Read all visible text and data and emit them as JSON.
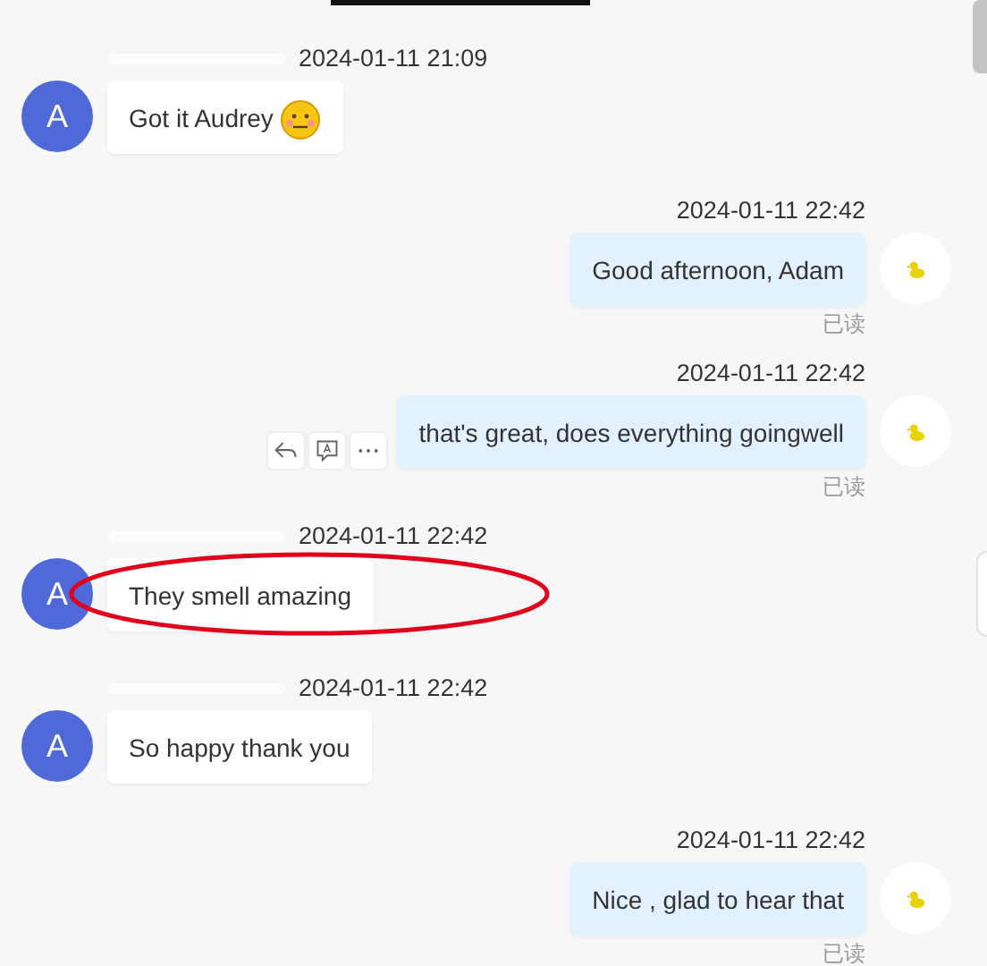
{
  "messages": [
    {
      "kind": "incoming",
      "avatar": "A",
      "time": "2024-01-11 21:09",
      "text": "Got it Audrey",
      "emoji": true,
      "highlighted": false
    },
    {
      "kind": "outgoing",
      "time": "2024-01-11 22:42",
      "text": "Good afternoon, Adam",
      "status": "已读",
      "show_actions": false
    },
    {
      "kind": "outgoing",
      "time": "2024-01-11 22:42",
      "text": "that's great, does everything goingwell",
      "status": "已读",
      "show_actions": true
    },
    {
      "kind": "incoming",
      "avatar": "A",
      "time": "2024-01-11 22:42",
      "text": "They smell amazing",
      "emoji": false,
      "highlighted": true
    },
    {
      "kind": "incoming",
      "avatar": "A",
      "time": "2024-01-11 22:42",
      "text": "So happy thank you",
      "emoji": false,
      "highlighted": false
    },
    {
      "kind": "outgoing",
      "time": "2024-01-11 22:42",
      "text": "Nice , glad to hear that",
      "status": "已读",
      "show_actions": false
    }
  ]
}
